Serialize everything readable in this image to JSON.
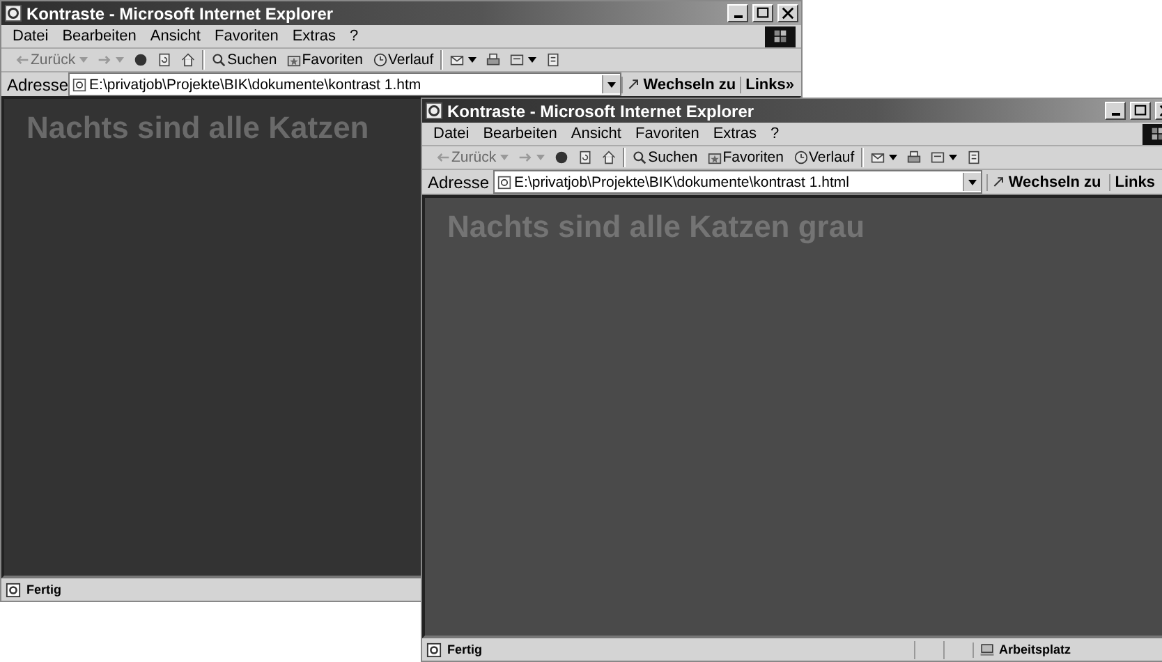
{
  "windows": [
    {
      "title": "Kontraste - Microsoft Internet Explorer",
      "menu": [
        "Datei",
        "Bearbeiten",
        "Ansicht",
        "Favoriten",
        "Extras",
        "?"
      ],
      "toolbar": [
        {
          "kind": "back",
          "label": "Zurück",
          "disabled": true
        },
        {
          "kind": "forward",
          "disabled": true
        },
        {
          "kind": "stop",
          "disabled": false
        },
        {
          "kind": "refresh",
          "disabled": false
        },
        {
          "kind": "home",
          "disabled": false
        },
        {
          "kind": "search",
          "label": "Suchen",
          "disabled": false
        },
        {
          "kind": "favorites",
          "label": "Favoriten",
          "disabled": false
        },
        {
          "kind": "history",
          "label": "Verlauf",
          "disabled": false
        },
        {
          "kind": "mail",
          "disabled": false
        },
        {
          "kind": "print",
          "disabled": false
        },
        {
          "kind": "edit",
          "disabled": false
        },
        {
          "kind": "discuss",
          "disabled": false
        }
      ],
      "address": {
        "label": "Adresse",
        "value": "E:\\privatjob\\Projekte\\BIK\\dokumente\\kontrast 1.htm"
      },
      "go": "Wechseln zu",
      "links": "Links",
      "links_more": "»",
      "content": {
        "heading": "Nachts sind alle Katzen"
      },
      "status": {
        "text": "Fertig"
      }
    },
    {
      "title": "Kontraste - Microsoft Internet Explorer",
      "menu": [
        "Datei",
        "Bearbeiten",
        "Ansicht",
        "Favoriten",
        "Extras",
        "?"
      ],
      "toolbar": [
        {
          "kind": "back",
          "label": "Zurück",
          "disabled": true
        },
        {
          "kind": "forward",
          "disabled": true
        },
        {
          "kind": "stop",
          "disabled": false
        },
        {
          "kind": "refresh",
          "disabled": false
        },
        {
          "kind": "home",
          "disabled": false
        },
        {
          "kind": "search",
          "label": "Suchen",
          "disabled": false
        },
        {
          "kind": "favorites",
          "label": "Favoriten",
          "disabled": false
        },
        {
          "kind": "history",
          "label": "Verlauf",
          "disabled": false
        },
        {
          "kind": "mail",
          "disabled": false
        },
        {
          "kind": "print",
          "disabled": false
        },
        {
          "kind": "edit",
          "disabled": false
        },
        {
          "kind": "discuss",
          "disabled": false
        }
      ],
      "address": {
        "label": "Adresse",
        "value": "E:\\privatjob\\Projekte\\BIK\\dokumente\\kontrast 1.html"
      },
      "go": "Wechseln zu",
      "links": "Links",
      "content": {
        "heading": "Nachts sind alle Katzen grau"
      },
      "status": {
        "text": "Fertig",
        "zone": "Arbeitsplatz"
      }
    }
  ]
}
